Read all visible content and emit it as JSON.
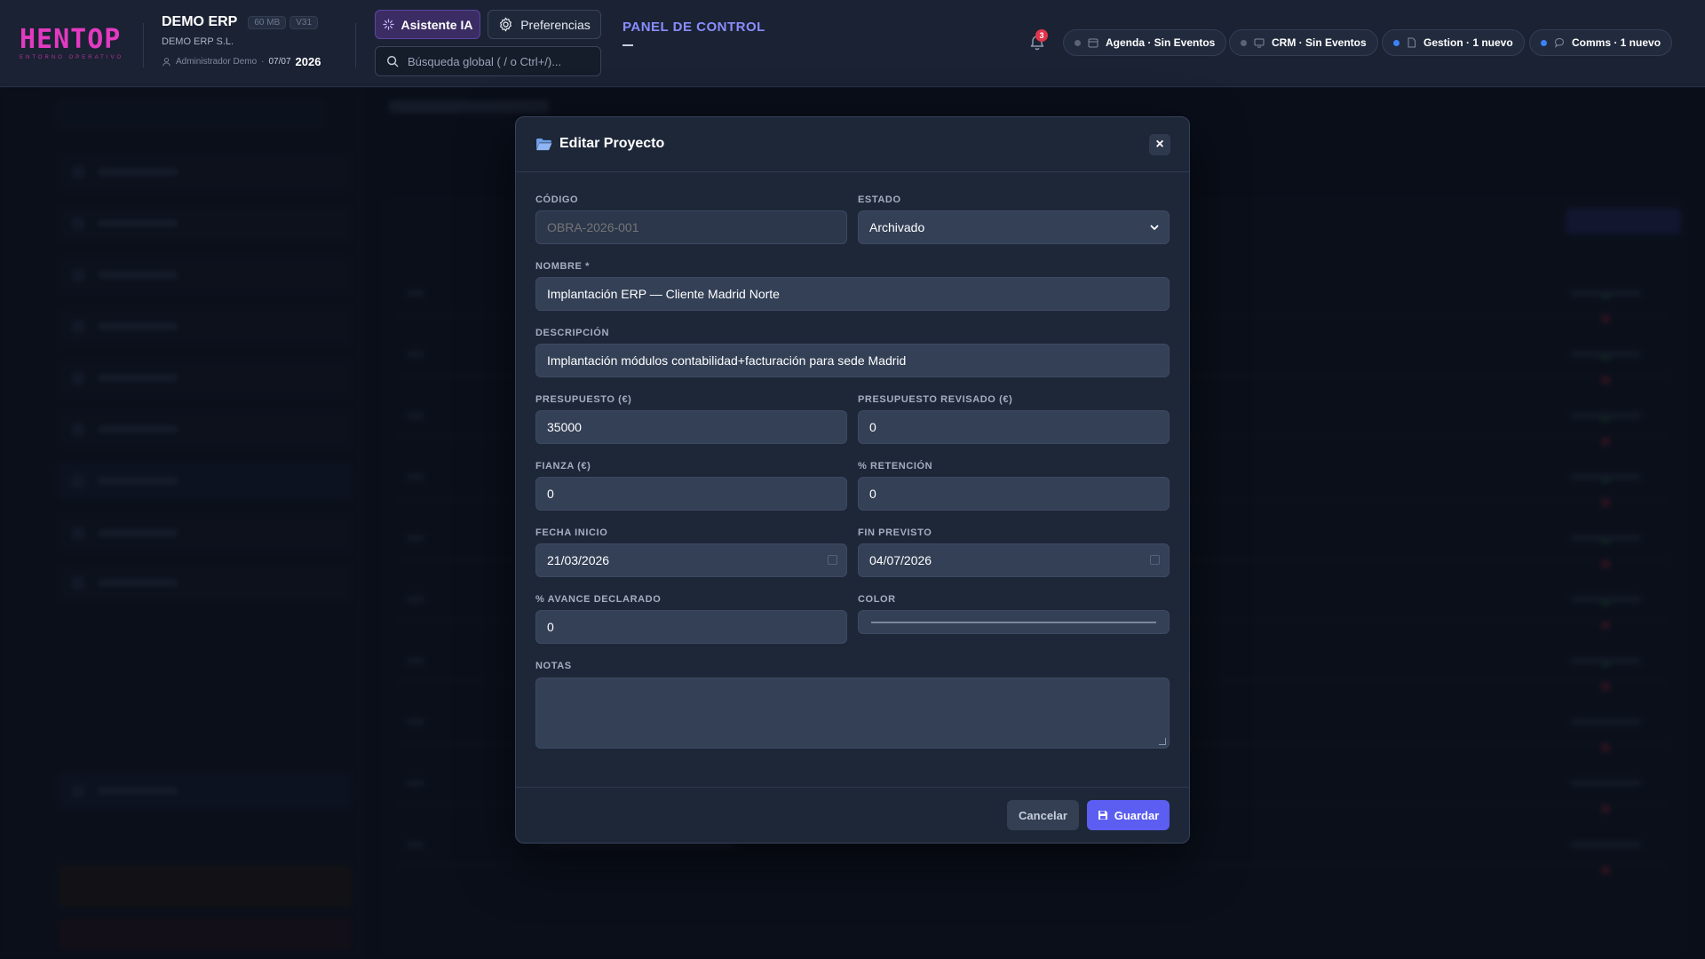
{
  "header": {
    "logo_text": "HENTOP",
    "logo_sub": "ENTORNO OPERATIVO",
    "company_name": "DEMO ERP",
    "storage_chip": "60 MB",
    "version_chip": "V31",
    "company_legal": "DEMO ERP S.L.",
    "user_name": "Administrador Demo",
    "separator": "·",
    "date": "07/07",
    "year": "2026",
    "ai_button": "Asistente IA",
    "preferences_button": "Preferencias",
    "search_placeholder": "Búsqueda global ( / o Ctrl+/)...",
    "panel_title": "PANEL DE CONTROL",
    "notification_count": "3",
    "pills": [
      {
        "label": "Agenda · Sin Eventos",
        "dot_color": "#5a6478"
      },
      {
        "label": "CRM · Sin Eventos",
        "dot_color": "#5a6478"
      },
      {
        "label": "Gestion · 1 nuevo",
        "dot_color": "#3b82f6"
      },
      {
        "label": "Comms · 1 nuevo",
        "dot_color": "#3b82f6"
      }
    ]
  },
  "modal": {
    "title": "Editar Proyecto",
    "close": "×",
    "codigo": {
      "label": "CÓDIGO",
      "placeholder": "OBRA-2026-001"
    },
    "estado": {
      "label": "ESTADO",
      "value": "Archivado"
    },
    "nombre": {
      "label": "NOMBRE *",
      "value": "Implantación ERP — Cliente Madrid Norte"
    },
    "descripcion": {
      "label": "DESCRIPCIÓN",
      "value": "Implantación módulos contabilidad+facturación para sede Madrid"
    },
    "presupuesto": {
      "label": "PRESUPUESTO (€)",
      "value": "35000"
    },
    "presupuesto_revisado": {
      "label": "PRESUPUESTO REVISADO (€)",
      "value": "0"
    },
    "fianza": {
      "label": "FIANZA (€)",
      "value": "0"
    },
    "retencion": {
      "label": "% RETENCIÓN",
      "value": "0"
    },
    "fecha_inicio": {
      "label": "FECHA INICIO",
      "value": "21/03/2026"
    },
    "fin_previsto": {
      "label": "FIN PREVISTO",
      "value": "04/07/2026"
    },
    "avance": {
      "label": "% AVANCE DECLARADO",
      "value": "0"
    },
    "color": {
      "label": "COLOR"
    },
    "notas": {
      "label": "NOTAS"
    },
    "cancel_button": "Cancelar",
    "save_button": "Guardar"
  },
  "colors": {
    "accent": "#5b5ef0",
    "panel_title": "#8a8dff",
    "logo": "#e23ac0",
    "badge": "#e0344a"
  }
}
